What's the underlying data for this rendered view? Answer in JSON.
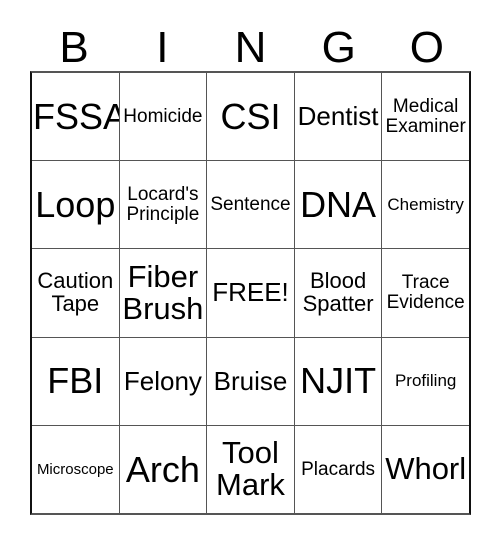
{
  "card": {
    "title": "BINGO",
    "header_letters": [
      "B",
      "I",
      "N",
      "G",
      "O"
    ],
    "free_space": "FREE!",
    "free_space_position": {
      "row": 2,
      "col": 2
    },
    "grid_size": "5x5",
    "colors": {
      "background": "#ffffff",
      "text": "#000000",
      "border": "#555555",
      "border_outer": "#111111"
    },
    "rows": [
      [
        {
          "text": "FSSA",
          "size": "fs-huge"
        },
        {
          "text": "Homicide",
          "size": "fs-md"
        },
        {
          "text": "CSI",
          "size": "fs-huge"
        },
        {
          "text": "Dentist",
          "size": "fs-xl"
        },
        {
          "text": "Medical\nExaminer",
          "size": "fs-md"
        }
      ],
      [
        {
          "text": "Loop",
          "size": "fs-huge"
        },
        {
          "text": "Locard's\nPrinciple",
          "size": "fs-md"
        },
        {
          "text": "Sentence",
          "size": "fs-md"
        },
        {
          "text": "DNA",
          "size": "fs-huge"
        },
        {
          "text": "Chemistry",
          "size": "fs-sm"
        }
      ],
      [
        {
          "text": "Caution\nTape",
          "size": "fs-lg"
        },
        {
          "text": "Fiber\nBrush",
          "size": "fs-xxl"
        },
        {
          "text": "FREE!",
          "size": "fs-xl"
        },
        {
          "text": "Blood\nSpatter",
          "size": "fs-lg"
        },
        {
          "text": "Trace\nEvidence",
          "size": "fs-md"
        }
      ],
      [
        {
          "text": "FBI",
          "size": "fs-huge"
        },
        {
          "text": "Felony",
          "size": "fs-xl"
        },
        {
          "text": "Bruise",
          "size": "fs-xl"
        },
        {
          "text": "NJIT",
          "size": "fs-huge"
        },
        {
          "text": "Profiling",
          "size": "fs-sm"
        }
      ],
      [
        {
          "text": "Microscope",
          "size": "fs-xs"
        },
        {
          "text": "Arch",
          "size": "fs-huge"
        },
        {
          "text": "Tool\nMark",
          "size": "fs-xxl"
        },
        {
          "text": "Placards",
          "size": "fs-md"
        },
        {
          "text": "Whorl",
          "size": "fs-xxl"
        }
      ]
    ]
  }
}
